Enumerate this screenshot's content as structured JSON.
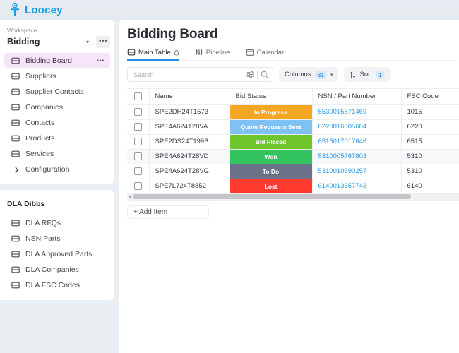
{
  "topbar": {
    "brand_name": "Loocey",
    "brand_color": "#1a9fe0"
  },
  "sidebar": {
    "workspace_label": "Workspace",
    "workspace_value": "Bidding",
    "workspace_menu_glyph": "•••",
    "items": [
      {
        "label": "Bidding Board",
        "icon": "table-icon",
        "active": true,
        "menu_glyph": "•••"
      },
      {
        "label": "Suppliers",
        "icon": "table-icon",
        "active": false
      },
      {
        "label": "Supplier Contacts",
        "icon": "table-icon",
        "active": false
      },
      {
        "label": "Companies",
        "icon": "table-icon",
        "active": false
      },
      {
        "label": "Contacts",
        "icon": "table-icon",
        "active": false
      },
      {
        "label": "Products",
        "icon": "table-icon",
        "active": false
      },
      {
        "label": "Services",
        "icon": "table-icon",
        "active": false
      }
    ],
    "configuration_label": "Configuration",
    "section2_title": "DLA Dibbs",
    "section2_items": [
      {
        "label": "DLA RFQs",
        "icon": "table-icon"
      },
      {
        "label": "NSN Parts",
        "icon": "table-icon"
      },
      {
        "label": "DLA Approved Parts",
        "icon": "table-icon"
      },
      {
        "label": "DLA Companies",
        "icon": "table-icon"
      },
      {
        "label": "DLA FSC Codes",
        "icon": "table-icon"
      }
    ]
  },
  "main": {
    "page_title": "Bidding Board",
    "tabs": [
      {
        "label": "Main Table",
        "icon": "table-icon",
        "locked": true,
        "active": true
      },
      {
        "label": "Pipeline",
        "icon": "pipeline-icon",
        "locked": false,
        "active": false
      },
      {
        "label": "Calendar",
        "icon": "calendar-icon",
        "locked": false,
        "active": false
      }
    ],
    "search": {
      "placeholder": "Search",
      "value": "",
      "filter_icon": "sliders-icon",
      "search_icon": "search-icon"
    },
    "columns_button": {
      "label": "Columns",
      "count": "31",
      "caret": "⌄"
    },
    "sort_button": {
      "label": "Sort",
      "count": "1",
      "icon": "sort-arrows-icon"
    },
    "add_item_label": "+ Add Item",
    "scroll_arrow": "◂"
  },
  "table": {
    "headers": [
      "Name",
      "Bid Status",
      "NSN / Part Number",
      "FSC Code"
    ],
    "rows": [
      {
        "name": "SPE2DH24T1573",
        "status": "In Progress",
        "status_color": "#F5A623",
        "nsn": "6530015571469",
        "fsc": "1015",
        "hover": false
      },
      {
        "name": "SPE4A624T28VA",
        "status": "Quote Requests Sent",
        "status_color": "#7FC1F2",
        "nsn": "6220016505604",
        "fsc": "6220",
        "hover": false
      },
      {
        "name": "SPE2DS24T199B",
        "status": "Bid Placed",
        "status_color": "#6FC62A",
        "nsn": "6515017017646",
        "fsc": "6515",
        "hover": false
      },
      {
        "name": "SPE4A624T28VD",
        "status": "Won",
        "status_color": "#32C35F",
        "nsn": "5310005767803",
        "fsc": "5310",
        "hover": true
      },
      {
        "name": "SPE4A624T28VG",
        "status": "To Do",
        "status_color": "#6B7189",
        "nsn": "5310010590257",
        "fsc": "5310",
        "hover": false
      },
      {
        "name": "SPE7L724T8852",
        "status": "Lost",
        "status_color": "#FF3B30",
        "nsn": "6140013657743",
        "fsc": "6140",
        "hover": false
      }
    ]
  }
}
